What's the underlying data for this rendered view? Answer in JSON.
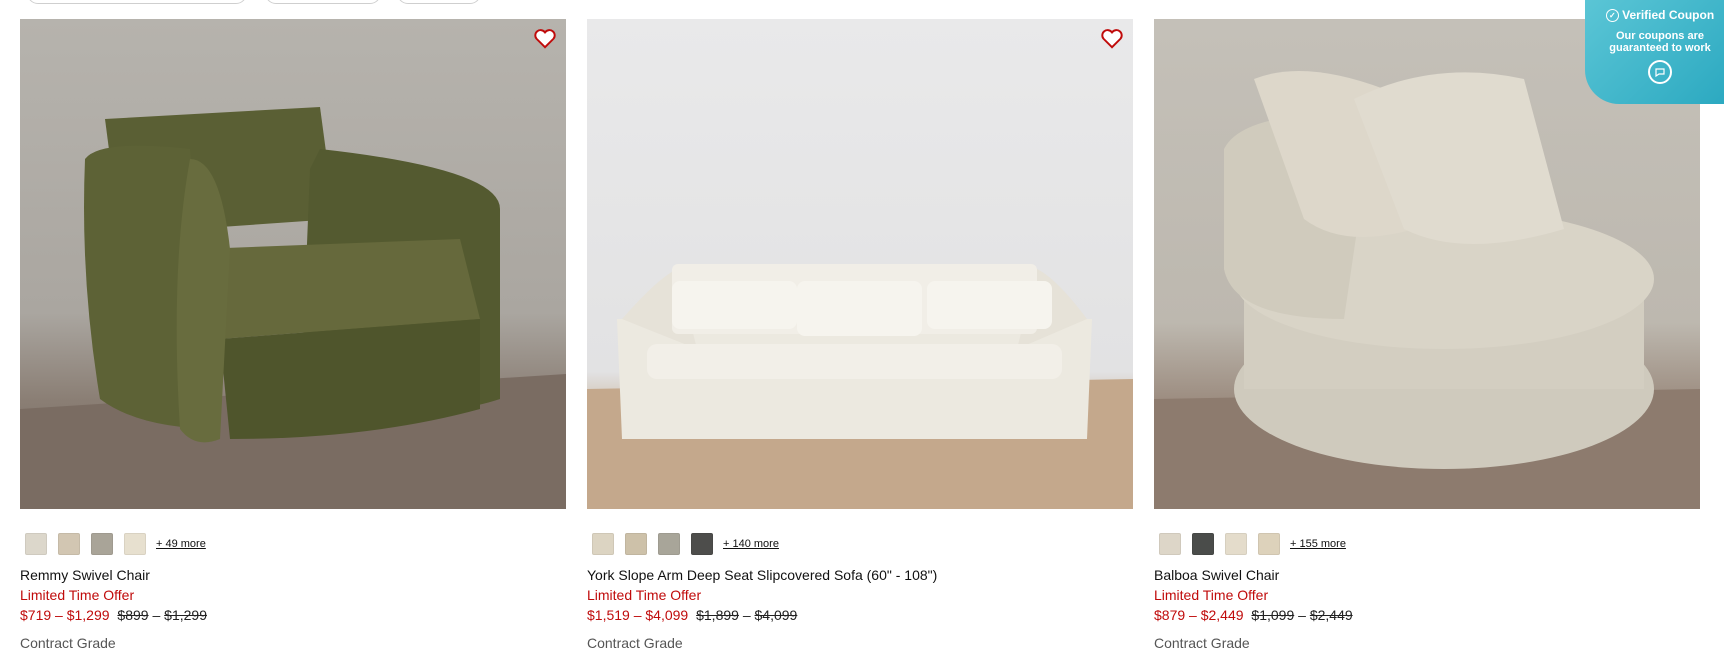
{
  "products": [
    {
      "name": "Remmy Swivel Chair",
      "offer": "Limited Time Offer",
      "sale_price": "$719 – $1,299",
      "orig_low": "$899",
      "orig_high": "$1,299",
      "grade": "Contract Grade",
      "more": "+ 49 more",
      "swatches": [
        "#dcd7cb",
        "#d2c6b2",
        "#a9a498",
        "#e7e0cf"
      ]
    },
    {
      "name": "York Slope Arm Deep Seat Slipcovered Sofa (60\" - 108\")",
      "offer": "Limited Time Offer",
      "sale_price": "$1,519 – $4,099",
      "orig_low": "$1,899",
      "orig_high": "$4,099",
      "grade": "Contract Grade",
      "more": "+ 140 more",
      "swatches": [
        "#dcd4c2",
        "#cdc1a9",
        "#a8a599",
        "#4d4d4b"
      ]
    },
    {
      "name": "Balboa Swivel Chair",
      "offer": "Limited Time Offer",
      "sale_price": "$879 – $2,449",
      "orig_low": "$1,099",
      "orig_high": "$2,449",
      "grade": "Contract Grade",
      "more": "+ 155 more",
      "swatches": [
        "#ddd6c8",
        "#4a4c4a",
        "#e4dccb",
        "#ddd2bb"
      ]
    }
  ],
  "coupon": {
    "title": "Verified Coupon",
    "line1": "Our coupons are",
    "line2": "guaranteed to work"
  },
  "colors": {
    "sale": "#c00b0b",
    "accent": "#2aa8c0"
  }
}
